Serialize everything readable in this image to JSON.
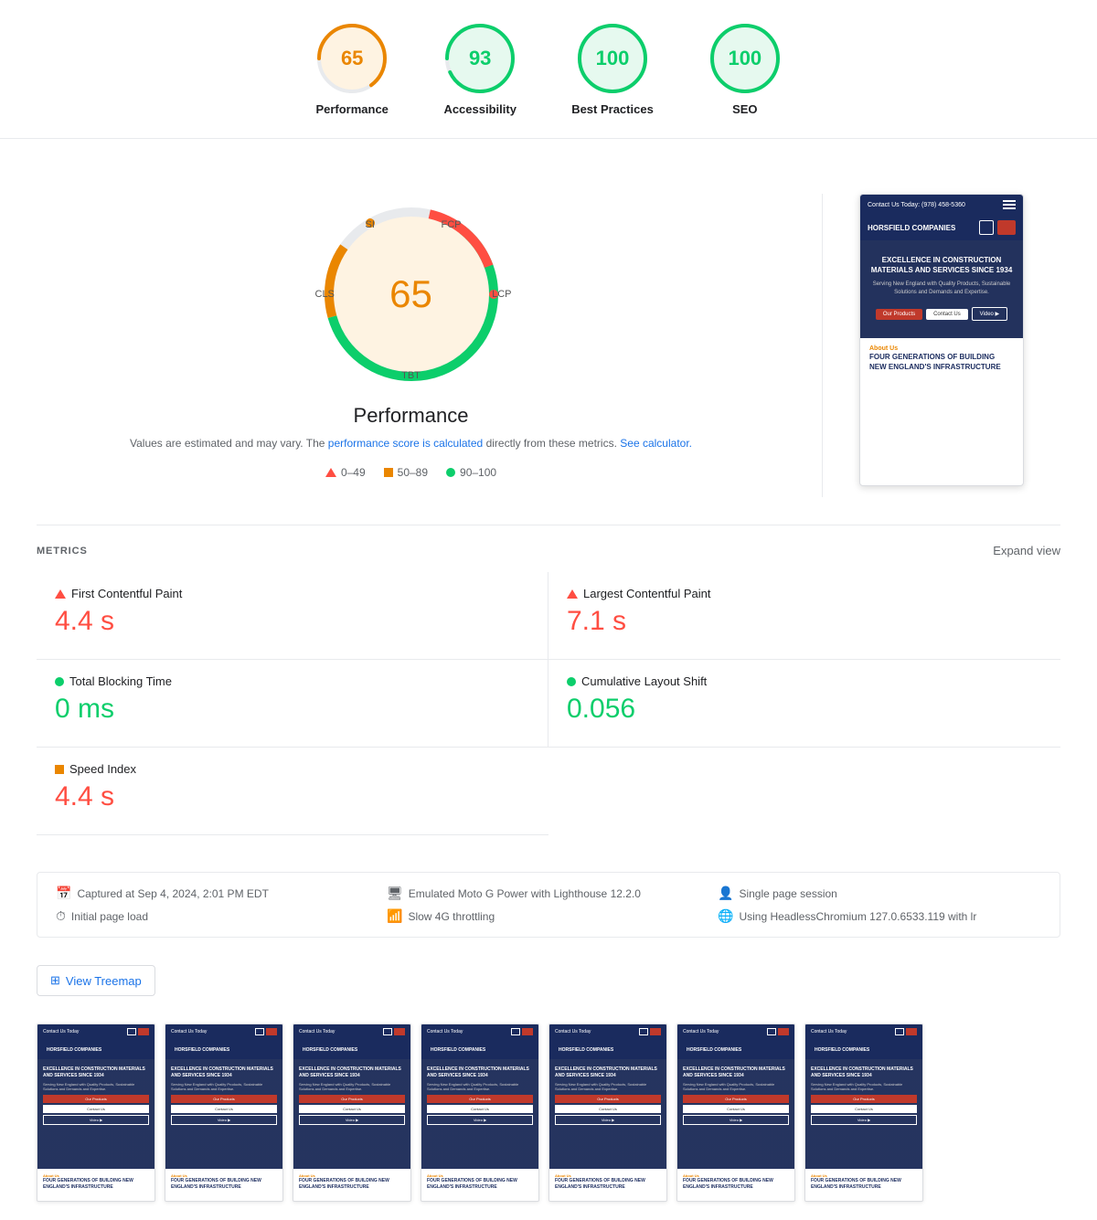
{
  "scores": [
    {
      "id": "performance",
      "value": 65,
      "label": "Performance",
      "color": "#ea8600",
      "strokeColor": "#ea8600",
      "bgColor": "#fef3e2",
      "textColor": "#ea8600",
      "percent": 65
    },
    {
      "id": "accessibility",
      "value": 93,
      "label": "Accessibility",
      "color": "#0cce6b",
      "strokeColor": "#0cce6b",
      "bgColor": "#e6f9ef",
      "textColor": "#0cce6b",
      "percent": 93
    },
    {
      "id": "best-practices",
      "value": 100,
      "label": "Best Practices",
      "color": "#0cce6b",
      "strokeColor": "#0cce6b",
      "bgColor": "#e6f9ef",
      "textColor": "#0cce6b",
      "percent": 100
    },
    {
      "id": "seo",
      "value": 100,
      "label": "SEO",
      "color": "#0cce6b",
      "strokeColor": "#0cce6b",
      "bgColor": "#e6f9ef",
      "textColor": "#0cce6b",
      "percent": 100
    }
  ],
  "gauge": {
    "center_value": "65",
    "title": "Performance",
    "note_text": "Values are estimated and may vary. The",
    "note_link1": "performance score is calculated",
    "note_mid": "directly from these metrics.",
    "note_link2": "See calculator.",
    "labels": {
      "si": "SI",
      "fcp": "FCP",
      "cls": "CLS",
      "lcp": "LCP",
      "tbt": "TBT"
    }
  },
  "legend": [
    {
      "type": "triangle-red",
      "range": "0–49"
    },
    {
      "type": "square-orange",
      "range": "50–89"
    },
    {
      "type": "circle-green",
      "range": "90–100"
    }
  ],
  "metrics": {
    "header": "METRICS",
    "expand": "Expand view",
    "items": [
      {
        "id": "fcp",
        "icon": "red",
        "name": "First Contentful Paint",
        "value": "4.4 s",
        "color": "red"
      },
      {
        "id": "lcp",
        "icon": "red",
        "name": "Largest Contentful Paint",
        "value": "7.1 s",
        "color": "red"
      },
      {
        "id": "tbt",
        "icon": "green",
        "name": "Total Blocking Time",
        "value": "0 ms",
        "color": "green"
      },
      {
        "id": "cls",
        "icon": "green",
        "name": "Cumulative Layout Shift",
        "value": "0.056",
        "color": "green"
      },
      {
        "id": "si",
        "icon": "orange",
        "name": "Speed Index",
        "value": "4.4 s",
        "color": "red"
      }
    ]
  },
  "info_bar": {
    "items": [
      {
        "icon": "📅",
        "text": "Captured at Sep 4, 2024, 2:01 PM EDT"
      },
      {
        "icon": "🖥",
        "text": "Emulated Moto G Power with Lighthouse 12.2.0"
      },
      {
        "icon": "👤",
        "text": "Single page session"
      },
      {
        "icon": "⏱",
        "text": "Initial page load"
      },
      {
        "icon": "📶",
        "text": "Slow 4G throttling"
      },
      {
        "icon": "🌐",
        "text": "Using HeadlessChromium 127.0.6533.119 with lr"
      }
    ]
  },
  "treemap": {
    "button_label": "View Treemap"
  },
  "phone": {
    "header_text": "Contact Us Today: (978) 458-5360",
    "logo": "HORSFIELD COMPANIES",
    "hero_title": "EXCELLENCE IN CONSTRUCTION MATERIALS AND SERVICES SINCE 1934",
    "hero_sub": "Serving New England with Quality Products, Sustainable Solutions and Demands and Expertise.",
    "btn1": "Our Products",
    "btn2": "Contact Us",
    "btn3": "Video ▶",
    "about_label": "About Us",
    "about_title": "FOUR GENERATIONS OF BUILDING NEW ENGLAND'S INFRASTRUCTURE"
  },
  "filmstrip": {
    "count": 7
  }
}
